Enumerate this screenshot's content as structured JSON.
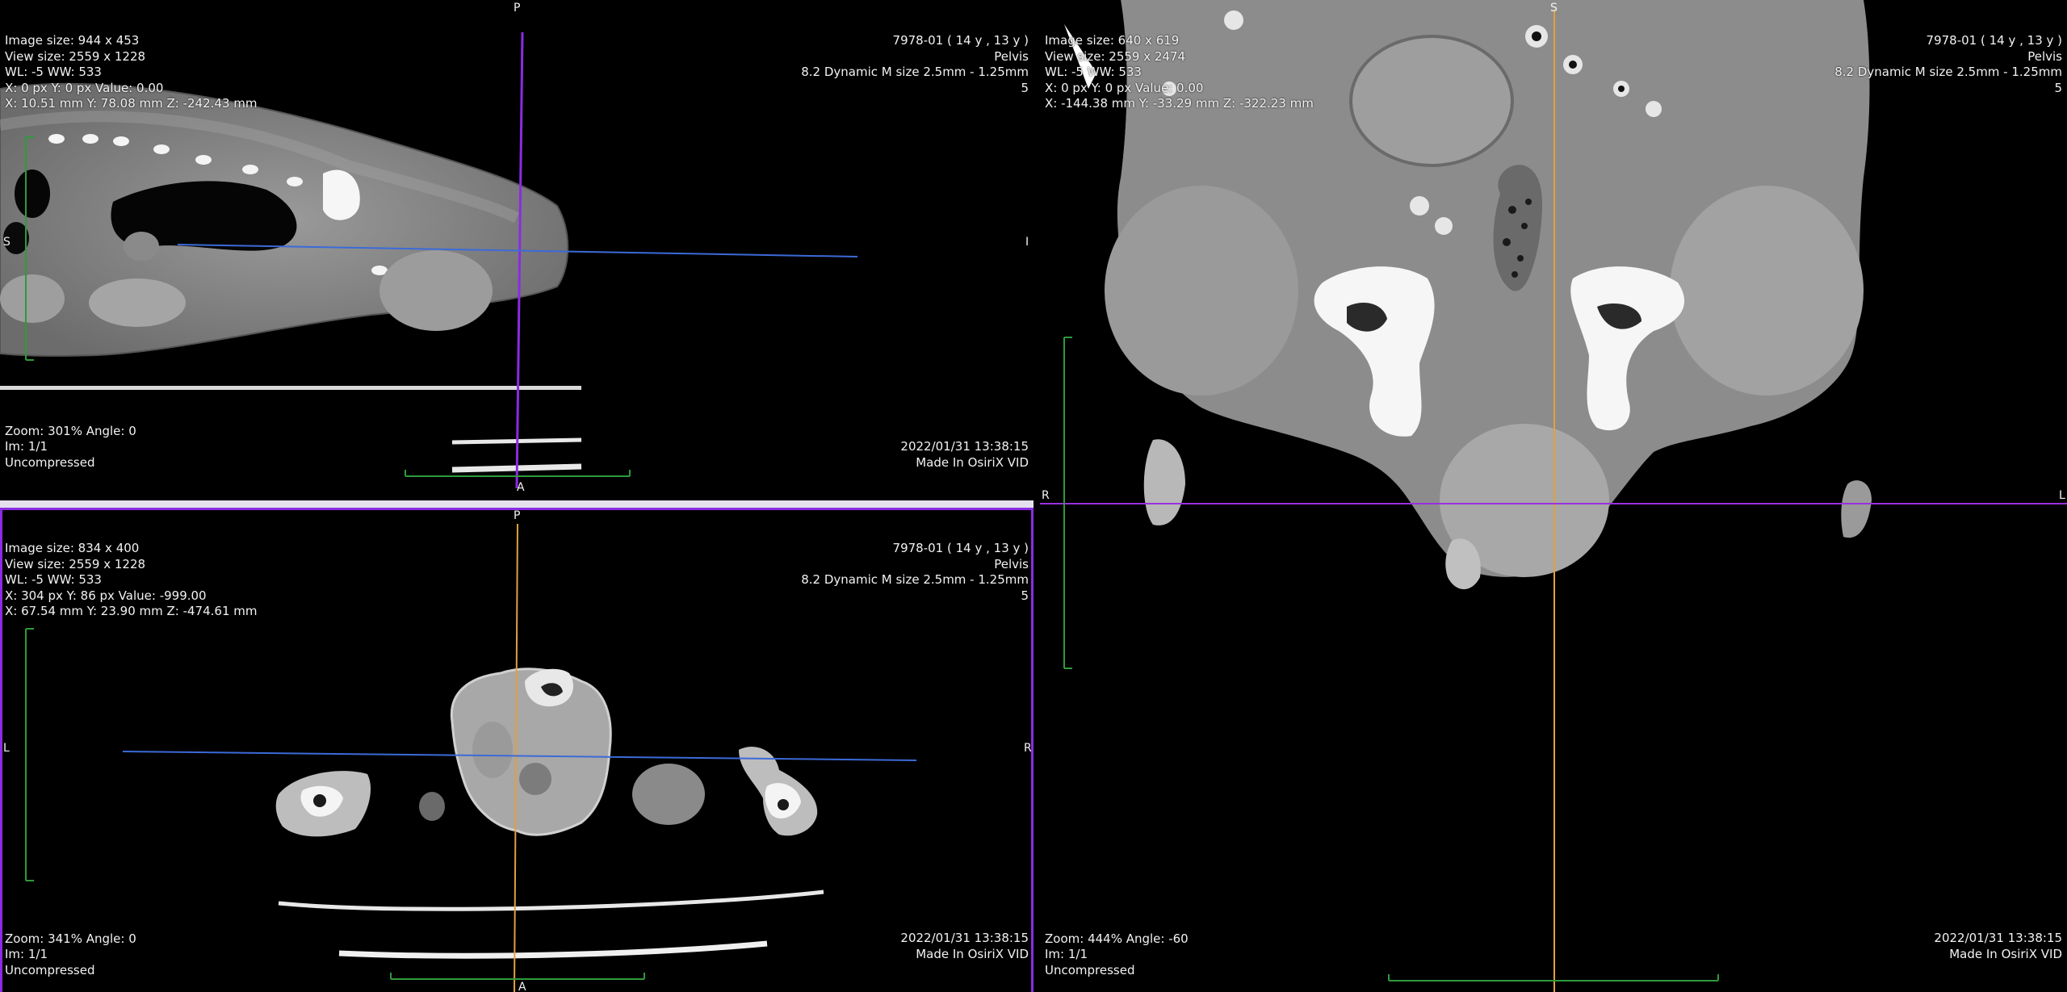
{
  "colors": {
    "background": "#000000",
    "active_frame": "#8b2be2",
    "header_strip": "#e4e0ee",
    "vertical_line_sagittal": "#8b2be2",
    "crosshair_orange": "#e0a040",
    "crosshair_blue": "#3c6ad8",
    "crosshair_purple": "#9b30e0",
    "scale_green": "#2e9a3a"
  },
  "viewports": {
    "sagittal": {
      "top_left": [
        "Image size: 944 x 453",
        "View size: 2559 x 1228",
        "WL: -5 WW: 533",
        "X: 0 px Y: 0 px Value: 0.00",
        "X: 10.51 mm Y: 78.08 mm Z: -242.43 mm"
      ],
      "top_right": [
        "7978-01 ( 14 y , 13 y )",
        "Pelvis",
        "8.2 Dynamic M size 2.5mm - 1.25mm",
        "5"
      ],
      "bottom_left": [
        "Zoom: 301% Angle: 0",
        "Im: 1/1",
        "Uncompressed"
      ],
      "bottom_right": [
        "2022/01/31 13:38:15",
        "Made In OsiriX VID"
      ],
      "orient": {
        "top": "P",
        "bottom": "A",
        "left": "S",
        "right": "I"
      },
      "icon": "ct-sagittal-slice"
    },
    "coronal": {
      "top_left": [
        "Image size: 640 x 619",
        "View size: 2559 x 2474",
        "WL: -5 WW: 533",
        "X: 0 px Y: 0 px Value: 0.00",
        "X: -144.38 mm Y: -33.29 mm Z: -322.23 mm"
      ],
      "top_right": [
        "7978-01 ( 14 y , 13 y )",
        "Pelvis",
        "8.2 Dynamic M size 2.5mm - 1.25mm",
        "5"
      ],
      "bottom_left": [
        "Zoom: 444% Angle: -60",
        "Im: 1/1",
        "Uncompressed"
      ],
      "bottom_right": [
        "2022/01/31 13:38:15",
        "Made In OsiriX VID"
      ],
      "orient": {
        "top": "S",
        "left": "R",
        "right": "L"
      },
      "icon": "ct-coronal-slice"
    },
    "axial": {
      "top_left": [
        "Image size: 834 x 400",
        "View size: 2559 x 1228",
        "WL: -5 WW: 533",
        "X: 304 px Y: 86 px Value: -999.00",
        "X: 67.54 mm Y: 23.90 mm Z: -474.61 mm"
      ],
      "top_right": [
        "7978-01 ( 14 y , 13 y )",
        "Pelvis",
        "8.2 Dynamic M size 2.5mm - 1.25mm",
        "5"
      ],
      "bottom_left": [
        "Zoom: 341% Angle: 0",
        "Im: 1/1",
        "Uncompressed"
      ],
      "bottom_right": [
        "2022/01/31 13:38:15",
        "Made In OsiriX VID"
      ],
      "orient": {
        "top": "P",
        "bottom": "A",
        "left": "L",
        "right": "R"
      },
      "icon": "ct-axial-slice"
    }
  }
}
